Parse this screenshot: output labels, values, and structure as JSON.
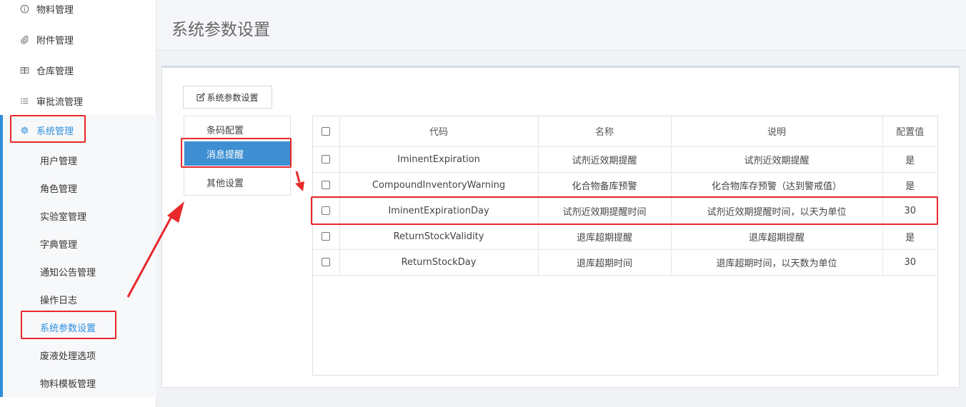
{
  "sidebar": {
    "top_items": [
      {
        "label": "物料管理",
        "icon": "info-icon"
      },
      {
        "label": "附件管理",
        "icon": "paperclip-icon"
      },
      {
        "label": "仓库管理",
        "icon": "book-icon"
      },
      {
        "label": "审批流管理",
        "icon": "list-icon"
      }
    ],
    "system": {
      "label": "系统管理",
      "icon": "gear-icon"
    },
    "sub_items": [
      "用户管理",
      "角色管理",
      "实验室管理",
      "字典管理",
      "通知公告管理",
      "操作日志",
      "系统参数设置",
      "废液处理选项",
      "物料模板管理"
    ],
    "active_sub": "系统参数设置"
  },
  "header": {
    "title": "系统参数设置"
  },
  "toolbar": {
    "button_label": "系统参数设置"
  },
  "tabs": [
    "条码配置",
    "消息提醒",
    "其他设置"
  ],
  "active_tab": "消息提醒",
  "table": {
    "headers": [
      "",
      "代码",
      "名称",
      "说明",
      "配置值"
    ],
    "rows": [
      [
        "IminentExpiration",
        "试剂近效期提醒",
        "试剂近效期提醒",
        "是"
      ],
      [
        "CompoundInventoryWarning",
        "化合物备库预警",
        "化合物库存预警（达到警戒值）",
        "是"
      ],
      [
        "IminentExpirationDay",
        "试剂近效期提醒时间",
        "试剂近效期提醒时间，以天为单位",
        "30"
      ],
      [
        "ReturnStockValidity",
        "退库超期提醒",
        "退库超期提醒",
        "是"
      ],
      [
        "ReturnStockDay",
        "退库超期时间",
        "退库超期时间，以天数为单位",
        "30"
      ]
    ]
  },
  "colors": {
    "accent": "#2f8fdc",
    "tab_active": "#3e8fd2",
    "annotation": "#e8282a"
  }
}
